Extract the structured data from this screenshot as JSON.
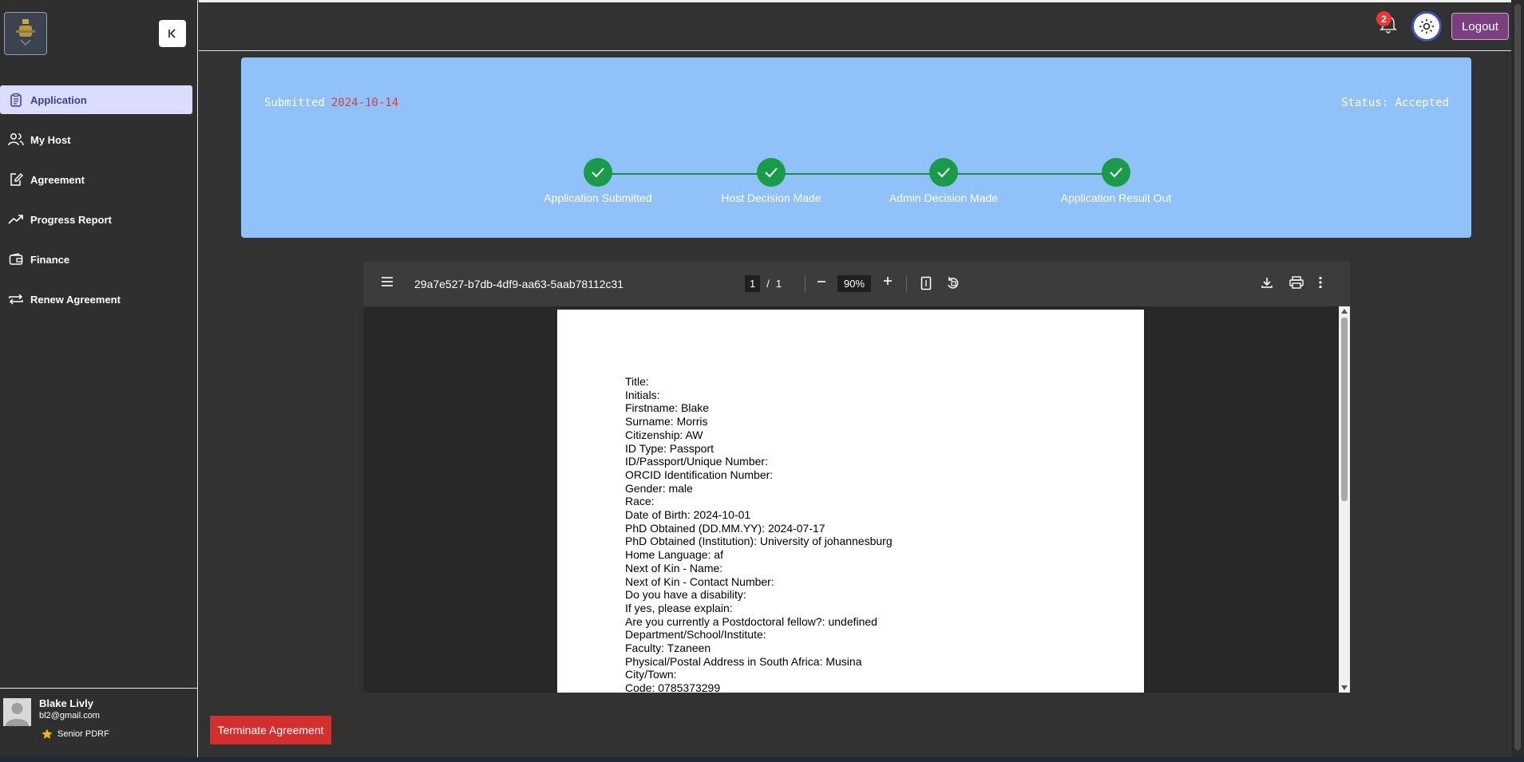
{
  "sidebar": {
    "items": [
      {
        "label": "Application",
        "icon": "clipboard-icon",
        "active": true
      },
      {
        "label": "My Host",
        "icon": "users-icon",
        "active": false
      },
      {
        "label": "Agreement",
        "icon": "edit-document-icon",
        "active": false
      },
      {
        "label": "Progress Report",
        "icon": "trending-up-icon",
        "active": false
      },
      {
        "label": "Finance",
        "icon": "wallet-icon",
        "active": false
      },
      {
        "label": "Renew Agreement",
        "icon": "repeat-icon",
        "active": false
      }
    ],
    "user": {
      "name": "Blake Livly",
      "email": "bl2@gmail.com",
      "role": "Senior PDRF"
    }
  },
  "topbar": {
    "notification_count": "2",
    "logout_label": "Logout"
  },
  "status": {
    "submitted_label": "Submitted",
    "submitted_date": "2024-10-14",
    "status_text": "Status: Accepted",
    "steps": [
      {
        "label": "Application Submitted",
        "done": true
      },
      {
        "label": "Host Decision Made",
        "done": true
      },
      {
        "label": "Admin Decision Made",
        "done": true
      },
      {
        "label": "Application Result Out",
        "done": true
      }
    ]
  },
  "pdf": {
    "filename": "29a7e527-b7db-4df9-aa63-5aab78112c31",
    "current_page": "1",
    "page_separator": "/",
    "total_pages": "1",
    "zoom": "90%",
    "lines": [
      "Title:",
      "Initials:",
      "Firstname: Blake",
      "Surname: Morris",
      "Citizenship: AW",
      "ID Type: Passport",
      "ID/Passport/Unique Number:",
      "ORCID Identification Number:",
      "Gender: male",
      "Race:",
      "Date of Birth: 2024-10-01",
      "PhD Obtained (DD.MM.YY): 2024-07-17",
      "PhD Obtained (Institution): University of johannesburg",
      "Home Language: af",
      "Next of Kin - Name:",
      "Next of Kin - Contact Number:",
      "Do you have a disability:",
      "If yes, please explain:",
      "Are you currently a Postdoctoral fellow?: undefined",
      "Department/School/Institute:",
      "Faculty: Tzaneen",
      "Physical/Postal Address in South Africa: Musina",
      "City/Town:",
      "Code: 0785373299"
    ]
  },
  "actions": {
    "terminate_label": "Terminate Agreement"
  },
  "colors": {
    "accent": "#3f51b5",
    "status_card": "#90c2f9",
    "step_done": "#1a9b4a",
    "danger": "#d32f2f",
    "logout": "#7b3f7f"
  }
}
